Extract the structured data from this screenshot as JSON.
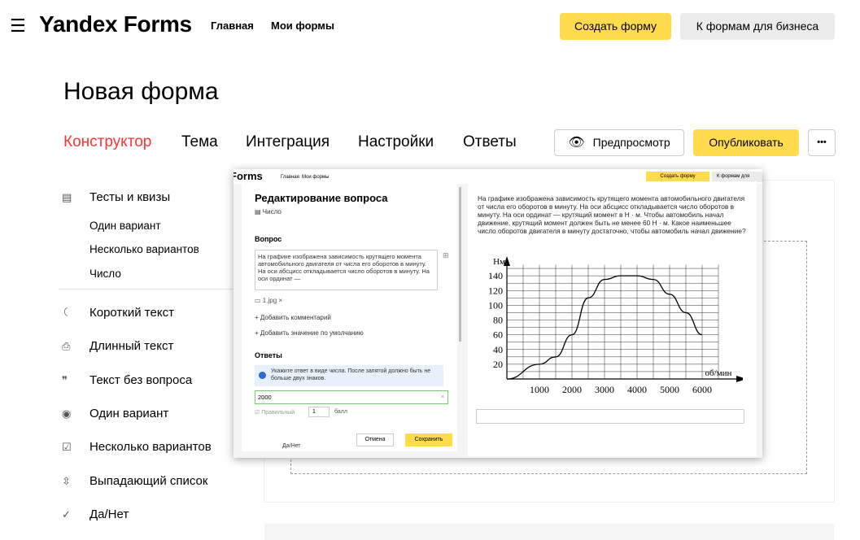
{
  "header": {
    "logo": "Yandex Forms",
    "nav": [
      "Главная",
      "Мои формы"
    ],
    "create_button": "Создать форму",
    "business_button": "К формам для бизнеса"
  },
  "page": {
    "title": "Новая форма",
    "tabs": [
      "Конструктор",
      "Тема",
      "Интеграция",
      "Настройки",
      "Ответы"
    ],
    "preview_button": "Предпросмотр",
    "publish_button": "Опубликовать",
    "more_button": "•••"
  },
  "sidebar": {
    "group": "Тесты и квизы",
    "sub_items": [
      "Один вариант",
      "Несколько вариантов",
      "Число"
    ],
    "items": [
      {
        "label": "Короткий текст",
        "icon": "short-text-icon"
      },
      {
        "label": "Длинный текст",
        "icon": "long-text-icon"
      },
      {
        "label": "Текст без вопроса",
        "icon": "quote-icon"
      },
      {
        "label": "Один вариант",
        "icon": "radio-icon"
      },
      {
        "label": "Несколько вариантов",
        "icon": "checkbox-icon"
      },
      {
        "label": "Выпадающий список",
        "icon": "dropdown-icon"
      },
      {
        "label": "Да/Нет",
        "icon": "check-icon"
      }
    ]
  },
  "modal": {
    "top_nav": [
      "Forms",
      "Главная",
      "Мои формы"
    ],
    "top_buttons": [
      "Создать форму",
      "К формам для"
    ],
    "title": "Редактирование вопроса",
    "type": "Число",
    "question_label": "Вопрос",
    "question_text": "На графике изображена зависимость крутящего момента автомобильного двигателя от числа его оборотов в минуту. На оси абсцисс откладывается число оборотов в минуту. На оси ординат —",
    "attachment": "1.jpg",
    "add_comment": "Добавить комментарий",
    "add_default": "Добавить значение по умолчанию",
    "answers_label": "Ответы",
    "info_text": "Укажите ответ в виде числа. После запятой должно быть не больше двух знаков.",
    "answer_value": "2000",
    "correct_label": "Правильный",
    "points_value": "1",
    "points_label": "балл",
    "cancel_button": "Отмена",
    "save_button": "Сохранить",
    "yes_no": "Да/Нет",
    "preview_question": "На графике изображена зависимость крутящего момента автомобильного двигателя от числа его оборотов в минуту. На оси абсцисс откладывается число оборотов в минуту. На оси ординат — крутящий момент в Н · м. Чтобы автомобиль начал движение, крутящий момент должен быть не менее 60 Н · м. Какое наименьшее число оборотов двигателя в минуту достаточно, чтобы автомобиль начал движение?"
  },
  "chart_data": {
    "type": "line",
    "xlabel": "об/мин",
    "ylabel": "Нм",
    "x_ticks": [
      1000,
      2000,
      3000,
      4000,
      5000,
      6000
    ],
    "y_ticks": [
      20,
      40,
      60,
      80,
      100,
      120,
      140
    ],
    "xlim": [
      0,
      7000
    ],
    "ylim": [
      0,
      160
    ],
    "x": [
      0,
      1000,
      1500,
      2000,
      2500,
      3000,
      3500,
      4000,
      4500,
      5000,
      5500,
      6000
    ],
    "y": [
      0,
      20,
      30,
      60,
      110,
      135,
      140,
      140,
      135,
      115,
      90,
      60
    ]
  }
}
